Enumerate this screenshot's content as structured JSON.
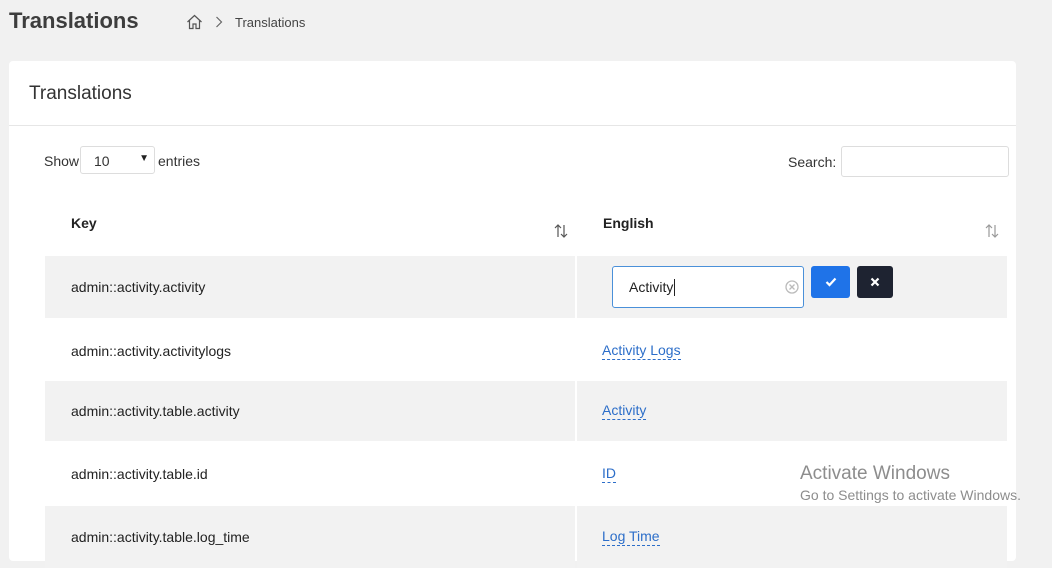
{
  "page": {
    "title": "Translations",
    "breadcrumb": {
      "home_icon": "home-icon",
      "separator_icon": "chevron-right-icon",
      "current": "Translations"
    }
  },
  "card": {
    "title": "Translations"
  },
  "controls": {
    "show_label": "Show",
    "page_size": "10",
    "entries_label": "entries",
    "search_label": "Search:",
    "search_value": ""
  },
  "table": {
    "columns": [
      "Key",
      "English"
    ],
    "rows": [
      {
        "key": "admin::activity.activity",
        "english": "Activity",
        "editing": true
      },
      {
        "key": "admin::activity.activitylogs",
        "english": "Activity Logs"
      },
      {
        "key": "admin::activity.table.activity",
        "english": "Activity"
      },
      {
        "key": "admin::activity.table.id",
        "english": "ID"
      },
      {
        "key": "admin::activity.table.log_time",
        "english": "Log Time"
      }
    ]
  },
  "editor": {
    "value": "Activity"
  },
  "watermark": {
    "title": "Activate Windows",
    "subtitle": "Go to Settings to activate Windows."
  },
  "colors": {
    "link": "#2c6ec9",
    "confirm": "#1f73e8",
    "cancel": "#1e2331",
    "row_shade": "#f2f2f2"
  }
}
